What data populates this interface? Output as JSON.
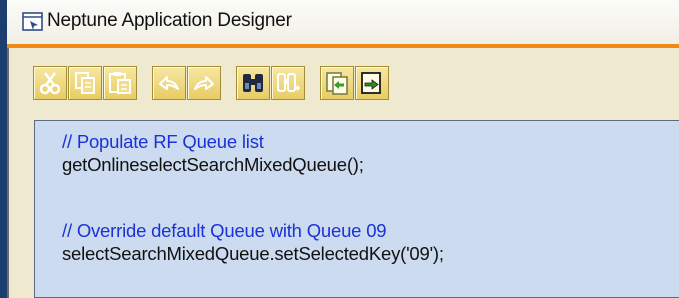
{
  "window": {
    "title": "Neptune Application Designer",
    "title_icon": "app-window-icon"
  },
  "colors": {
    "accent_orange": "#f08a16",
    "editor_background": "#ccdbf0",
    "toolbar_background": "#efe9cf",
    "comment_color": "#1a32d6",
    "left_accent": "#1b3e6f"
  },
  "toolbar": {
    "buttons": [
      {
        "icon": "cut-icon"
      },
      {
        "icon": "copy-icon"
      },
      {
        "icon": "paste-icon"
      },
      {
        "icon": "undo-icon"
      },
      {
        "icon": "redo-icon"
      },
      {
        "icon": "find-icon"
      },
      {
        "icon": "find-replace-icon"
      },
      {
        "icon": "import-icon"
      },
      {
        "icon": "export-icon"
      }
    ]
  },
  "editor": {
    "lines": [
      {
        "text": "// Populate RF Queue list",
        "kind": "comment"
      },
      {
        "text": "getOnlineselectSearchMixedQueue();",
        "kind": "code"
      },
      {
        "text": "",
        "kind": "blank"
      },
      {
        "text": "// Override default Queue with Queue 09",
        "kind": "comment"
      },
      {
        "text": "selectSearchMixedQueue.setSelectedKey('09');",
        "kind": "code"
      }
    ]
  }
}
